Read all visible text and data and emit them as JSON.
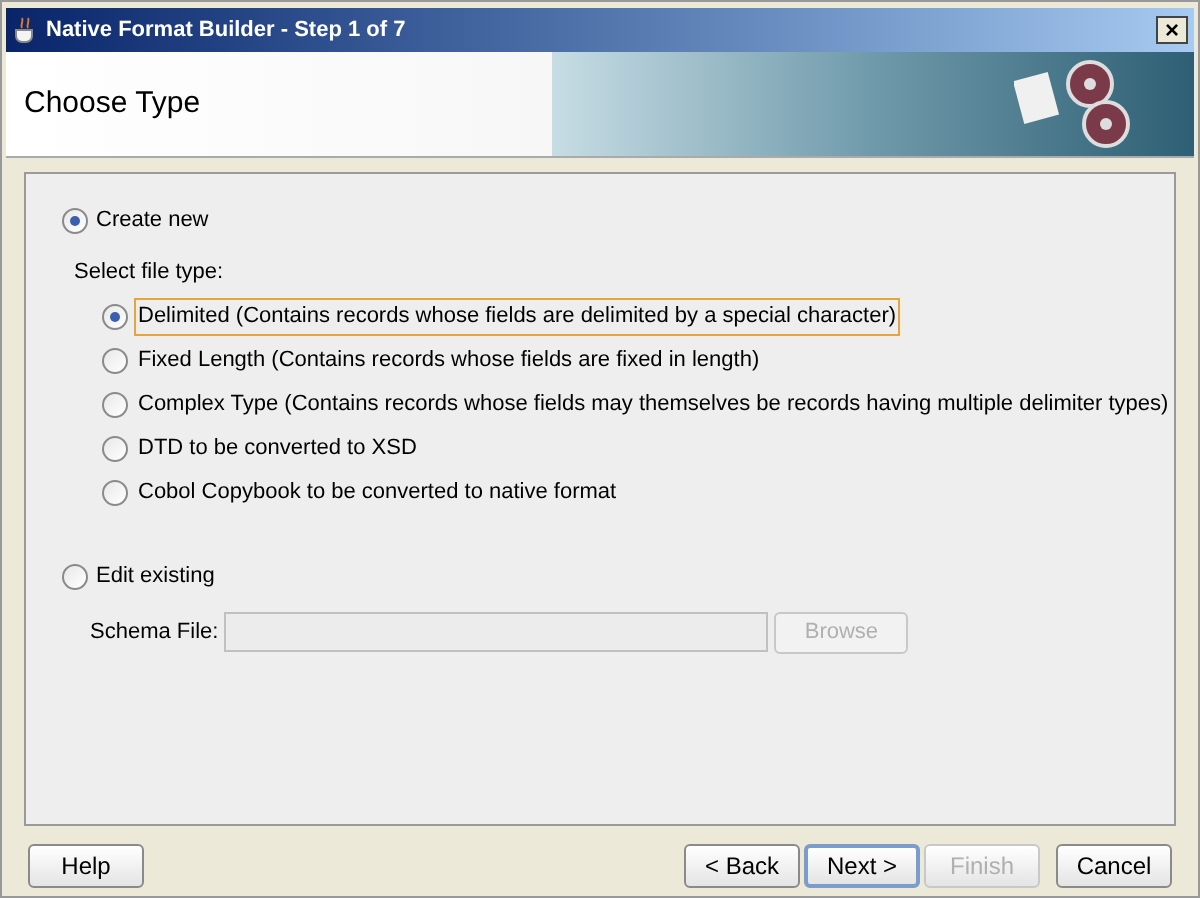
{
  "window": {
    "title": "Native Format Builder - Step 1 of 7",
    "close": "×"
  },
  "header": {
    "title": "Choose Type"
  },
  "modes": [
    {
      "label": "Create new",
      "selected": true
    },
    {
      "label": "Edit existing",
      "selected": false
    }
  ],
  "file_type_label": "Select file type:",
  "file_types": [
    {
      "label": "Delimited (Contains records whose fields are delimited by a special character)",
      "selected": true,
      "focused": true
    },
    {
      "label": "Fixed Length (Contains records whose fields are fixed in length)",
      "selected": false,
      "focused": false
    },
    {
      "label": "Complex Type (Contains records whose fields may themselves be records having multiple delimiter types)",
      "selected": false,
      "focused": false
    },
    {
      "label": "DTD to be converted to XSD",
      "selected": false,
      "focused": false
    },
    {
      "label": "Cobol Copybook to be converted to native format",
      "selected": false,
      "focused": false
    }
  ],
  "schema_file": {
    "label": "Schema File:",
    "disabled": true,
    "browse": {
      "label": "Browse",
      "disabled": true
    }
  },
  "buttons": [
    {
      "label": "Help",
      "disabled": false,
      "default": false
    },
    {
      "label": "< Back",
      "disabled": false,
      "default": false
    },
    {
      "label": "Next >",
      "disabled": false,
      "default": true
    },
    {
      "label": "Finish",
      "disabled": true,
      "default": false
    },
    {
      "label": "Cancel",
      "disabled": false,
      "default": false
    }
  ]
}
